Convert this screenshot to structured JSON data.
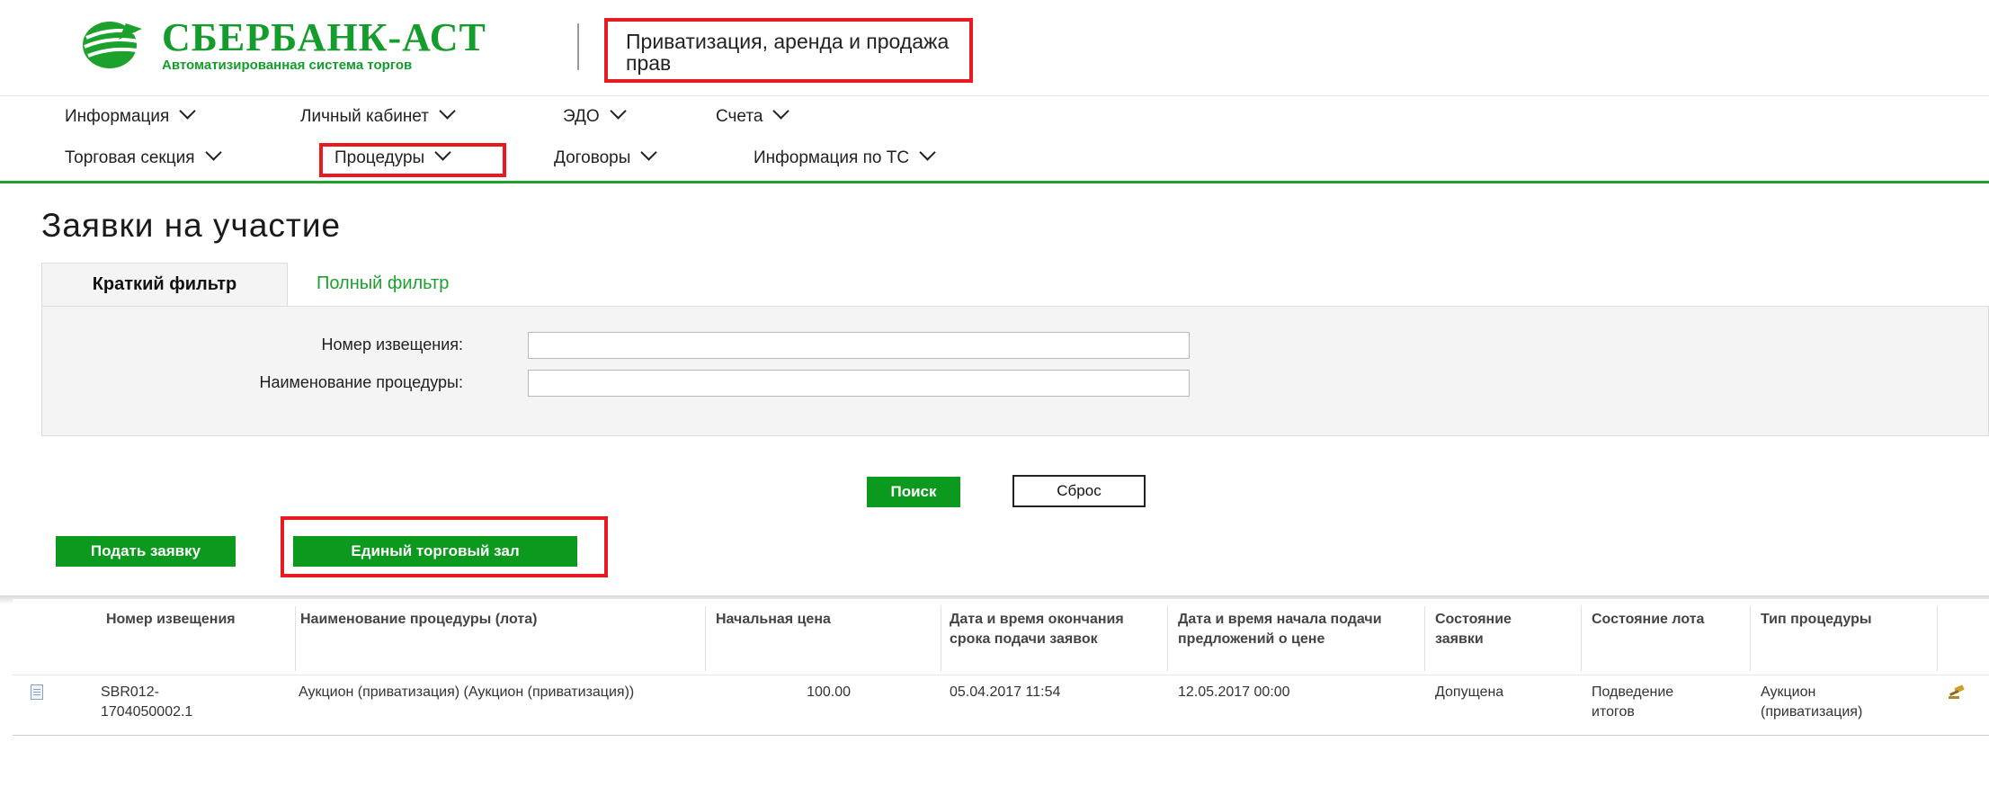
{
  "header": {
    "logo_name": "СБЕРБАНК-АСТ",
    "logo_subtitle": "Автоматизированная система торгов",
    "section_title": "Приватизация, аренда и продажа прав"
  },
  "nav_primary": [
    {
      "label": "Информация"
    },
    {
      "label": "Личный кабинет"
    },
    {
      "label": "ЭДО"
    },
    {
      "label": "Счета"
    }
  ],
  "nav_secondary": [
    {
      "label": "Торговая секция"
    },
    {
      "label": "Процедуры"
    },
    {
      "label": "Договоры"
    },
    {
      "label": "Информация по ТС"
    }
  ],
  "page": {
    "title": "Заявки на участие"
  },
  "filter": {
    "tab_short": "Краткий фильтр",
    "tab_full": "Полный фильтр",
    "notice_number_label": "Номер извещения:",
    "notice_number_value": "",
    "procedure_name_label": "Наименование процедуры:",
    "procedure_name_value": "",
    "search_button": "Поиск",
    "reset_button": "Сброс"
  },
  "actions": {
    "submit_application": "Подать заявку",
    "trading_hall": "Единый торговый зал"
  },
  "table": {
    "headers": [
      "Номер извещения",
      "Наименование процедуры (лота)",
      "Начальная цена",
      "Дата и время окончания срока подачи заявок",
      "Дата и время начала подачи предложений о цене",
      "Состояние заявки",
      "Состояние лота",
      "Тип процедуры"
    ],
    "rows": [
      {
        "notice_number": "SBR012-1704050002.1",
        "procedure_name": "Аукцион (приватизация) (Аукцион (приватизация))",
        "start_price": "100.00",
        "deadline": "05.04.2017 11:54",
        "bidding_start": "12.05.2017 00:00",
        "application_state": "Допущена",
        "lot_state": "Подведение итогов",
        "procedure_type": "Аукцион (приватизация)"
      }
    ]
  },
  "colors": {
    "brand_green": "#1ba12c",
    "button_green": "#0b9a1e",
    "highlight_red": "#e8191f"
  },
  "icons": [
    "sberbank-logo-icon",
    "chevron-down-icon",
    "document-icon",
    "auction-hammer-icon"
  ]
}
